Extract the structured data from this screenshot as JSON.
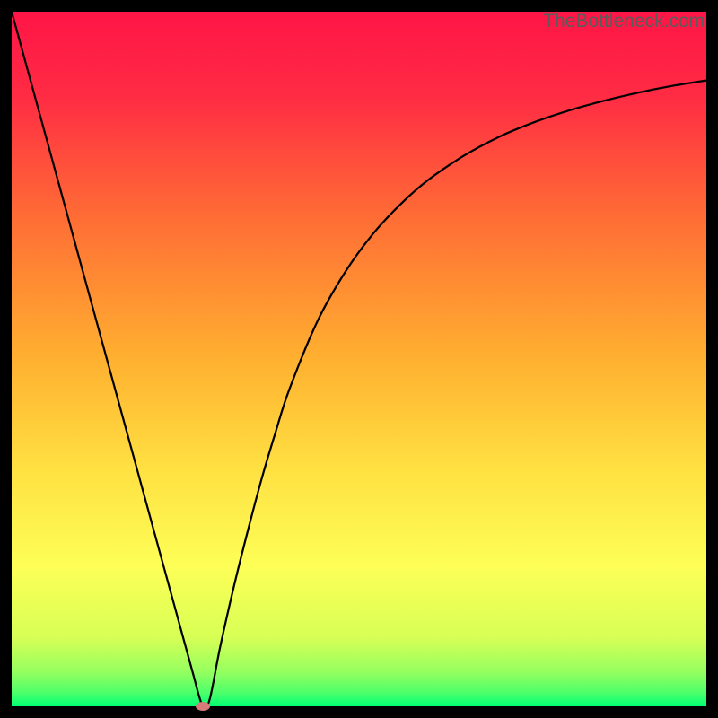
{
  "attribution": "TheBottleneck.com",
  "colors": {
    "top": "#ff1546",
    "mid_upper": "#ff7d2e",
    "mid": "#ffd330",
    "mid_lower": "#fff763",
    "lower": "#e7ff5a",
    "bottom": "#00ff74",
    "curve": "#000000",
    "frame": "#000000",
    "marker": "#d67a7a"
  },
  "chart_data": {
    "type": "line",
    "title": "",
    "xlabel": "",
    "ylabel": "",
    "xlim": [
      0,
      100
    ],
    "ylim": [
      0,
      100
    ],
    "x": [
      0,
      2,
      4,
      6,
      8,
      10,
      12,
      14,
      16,
      18,
      20,
      22,
      24,
      26,
      27.5,
      28.5,
      30,
      32,
      34,
      36,
      38,
      40,
      44,
      48,
      52,
      56,
      60,
      65,
      70,
      75,
      80,
      85,
      90,
      95,
      100
    ],
    "y": [
      100,
      92.7,
      85.4,
      78.1,
      70.8,
      63.5,
      56.2,
      48.9,
      41.6,
      34.3,
      27.0,
      19.7,
      12.4,
      5.1,
      0,
      1.0,
      8.5,
      17.3,
      25.3,
      32.8,
      39.5,
      45.7,
      55.4,
      62.5,
      68.0,
      72.3,
      75.8,
      79.2,
      81.9,
      84.0,
      85.7,
      87.1,
      88.3,
      89.3,
      90.1
    ],
    "min_point": {
      "x": 27.5,
      "y": 0
    },
    "annotations": []
  }
}
